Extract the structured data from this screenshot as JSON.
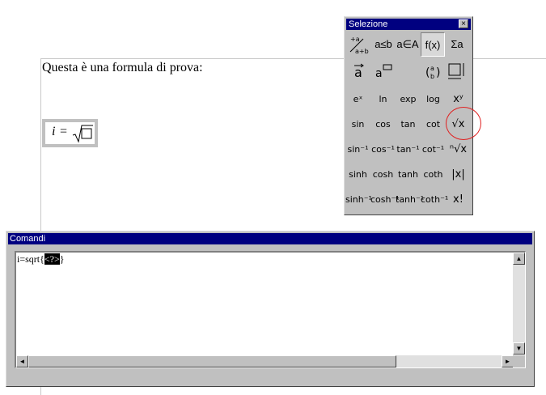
{
  "document": {
    "text": "Questa è una formula di prova:",
    "formula": {
      "var": "i",
      "eq": "="
    }
  },
  "palette": {
    "title": "Selezione",
    "close_glyph": "×",
    "categories": [
      "a≤b",
      "a∈A",
      "f(x)",
      "Σa"
    ],
    "rows": [
      [
        "eˣ",
        "ln",
        "exp",
        "log",
        "xʸ"
      ],
      [
        "sin",
        "cos",
        "tan",
        "cot",
        "√x"
      ],
      [
        "sin⁻¹",
        "cos⁻¹",
        "tan⁻¹",
        "cot⁻¹",
        "ⁿ√x"
      ],
      [
        "sinh",
        "cosh",
        "tanh",
        "coth",
        "|x|"
      ],
      [
        "sinh⁻¹",
        "cosh⁻¹",
        "tanh⁻¹",
        "coth⁻¹",
        "x!"
      ]
    ]
  },
  "commands": {
    "title": "Comandi",
    "text_before": "i=sqrt{",
    "placeholder": "<?>",
    "text_after": "}",
    "scroll_up": "▲",
    "scroll_down": "▼",
    "scroll_left": "◄",
    "scroll_right": "►"
  }
}
